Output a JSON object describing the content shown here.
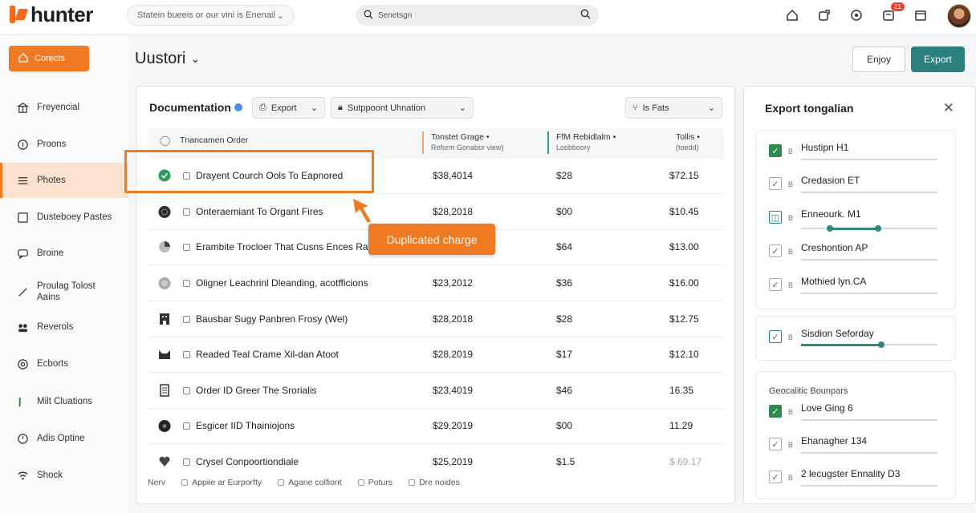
{
  "app": {
    "name": "hunter"
  },
  "topbar": {
    "select_text": "Statein bueeis or our vini is Enenail",
    "search_text": "Senetsgn",
    "notification_count": "21"
  },
  "sidebar": {
    "primary_label": "Corects",
    "items": [
      {
        "label": "Freyencial",
        "icon": "bank-icon"
      },
      {
        "label": "Proons",
        "icon": "info-circle-icon"
      },
      {
        "label": "Photes",
        "icon": "list-icon",
        "active": true
      },
      {
        "label": "Dusteboey Pastes",
        "icon": "square-icon"
      },
      {
        "label": "Broine",
        "icon": "chat-icon"
      },
      {
        "label": "Proulag Tolost Aains",
        "icon": "pen-icon"
      },
      {
        "label": "Reverols",
        "icon": "users-icon"
      },
      {
        "label": "Ecborts",
        "icon": "at-icon"
      },
      {
        "label": "Milt Cluations",
        "icon": "bar-icon"
      },
      {
        "label": "Adis Optine",
        "icon": "clock-icon"
      },
      {
        "label": "Shock",
        "icon": "wifi-icon"
      }
    ]
  },
  "header": {
    "title": "Uustori",
    "enjoy_label": "Enjoy",
    "export_label": "Export"
  },
  "main": {
    "title": "Documentation",
    "toolbar": {
      "export_label": "Export",
      "support_label": "Sutppoont Uhnation",
      "filter_label": "Is Fats"
    },
    "columns": [
      {
        "label": "Tnancamen Order",
        "sub": ""
      },
      {
        "label": "Tonstet Grage •",
        "sub": "Reform Gonabor view)"
      },
      {
        "label": "FfM Rebidlalm •",
        "sub": "Loobboory"
      },
      {
        "label": "Tollis •",
        "sub": "(toedd)"
      }
    ],
    "rows": [
      {
        "name": "Drayent Courch Ools To Eapnored",
        "amt1": "$38,4014",
        "amt2": "$28",
        "amt3": "$72.15",
        "icon": "check-circle-icon"
      },
      {
        "name": "Onteraemiant To Organt Fires",
        "amt1": "$28,2018",
        "amt2": "$00",
        "amt3": "$10.45",
        "icon": "globe-icon"
      },
      {
        "name": "Erambite Trocloer That Cusns Ences Rates",
        "amt1": "",
        "amt2": "$64",
        "amt3": "$13.00",
        "icon": "pie-icon"
      },
      {
        "name": "Oligner Leachrinl Dleanding, acotfficions",
        "amt1": "$23,2012",
        "amt2": "$36",
        "amt3": "$16.00",
        "icon": "coin-icon"
      },
      {
        "name": "Bausbar Sugy Panbren Frosy (Wel)",
        "amt1": "$28,2018",
        "amt2": "$28",
        "amt3": "$12.75",
        "icon": "building-icon"
      },
      {
        "name": "Readed Teal Crame Xil-dan Atoot",
        "amt1": "$28,2019",
        "amt2": "$17",
        "amt3": "$12.10",
        "icon": "cat-icon"
      },
      {
        "name": "Order ID Greer The Srorialis",
        "amt1": "$23,4019",
        "amt2": "$46",
        "amt3": "16.35",
        "icon": "document-icon"
      },
      {
        "name": "Esgicer IID Thainiojons",
        "amt1": "$29,2019",
        "amt2": "$00",
        "amt3": "11.29",
        "icon": "disc-icon"
      },
      {
        "name": "Crysel Conpoortiondiale",
        "amt1": "$25,2019",
        "amt2": "$1.5",
        "amt3": "$.69.17",
        "icon": "heart-icon"
      }
    ],
    "footer": {
      "first": "Nerv",
      "filters": [
        "Appiie ar Eurporfty",
        "Agane colfiont",
        "Poturs",
        "Dre noides"
      ]
    },
    "callout": "Duplicated charge"
  },
  "right_panel": {
    "title": "Export tongalian",
    "group1": [
      {
        "label": "Hustipn H1",
        "state": "on"
      },
      {
        "label": "Credasion ET",
        "state": "off"
      },
      {
        "label": "Enneourk. M1",
        "state": "teal",
        "slider": 0.45
      },
      {
        "label": "Creshontion AP",
        "state": "off"
      },
      {
        "label": "Mothied lyn.CA",
        "state": "off"
      }
    ],
    "group2": [
      {
        "label": "Sisdion Seforday",
        "state": "teal",
        "slider": 0.6
      }
    ],
    "group3_title": "Geocalitic Bounpars",
    "group3": [
      {
        "label": "Love Ging 6",
        "state": "on"
      },
      {
        "label": "Ehanagher 134",
        "state": "off"
      },
      {
        "label": "2 lecugster Ennality D3",
        "state": "off"
      }
    ],
    "check_small": "B"
  },
  "colors": {
    "accent": "#f07a22",
    "teal": "#2a7f7f",
    "green": "#2f8a4e"
  }
}
